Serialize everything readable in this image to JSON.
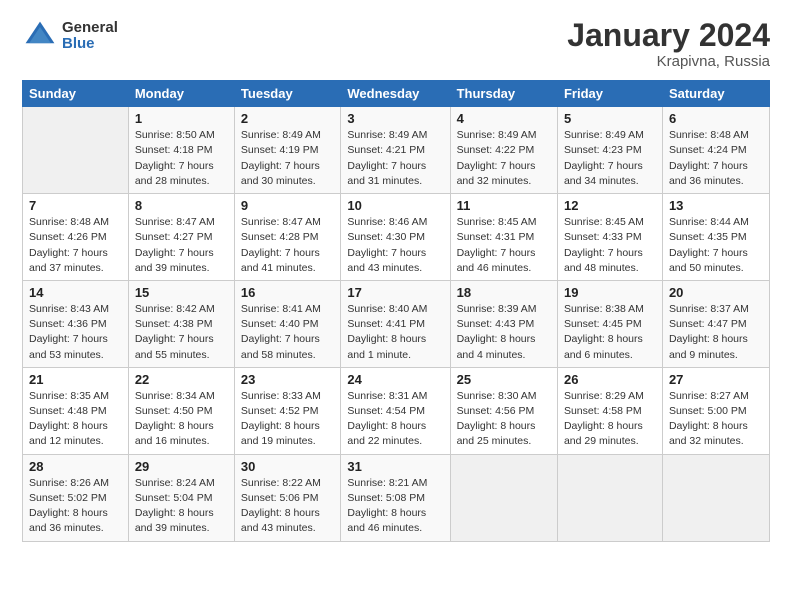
{
  "logo": {
    "general": "General",
    "blue": "Blue"
  },
  "title": "January 2024",
  "subtitle": "Krapivna, Russia",
  "days_header": [
    "Sunday",
    "Monday",
    "Tuesday",
    "Wednesday",
    "Thursday",
    "Friday",
    "Saturday"
  ],
  "weeks": [
    [
      {
        "day": "",
        "sunrise": "",
        "sunset": "",
        "daylight": ""
      },
      {
        "day": "1",
        "sunrise": "Sunrise: 8:50 AM",
        "sunset": "Sunset: 4:18 PM",
        "daylight": "Daylight: 7 hours and 28 minutes."
      },
      {
        "day": "2",
        "sunrise": "Sunrise: 8:49 AM",
        "sunset": "Sunset: 4:19 PM",
        "daylight": "Daylight: 7 hours and 30 minutes."
      },
      {
        "day": "3",
        "sunrise": "Sunrise: 8:49 AM",
        "sunset": "Sunset: 4:21 PM",
        "daylight": "Daylight: 7 hours and 31 minutes."
      },
      {
        "day": "4",
        "sunrise": "Sunrise: 8:49 AM",
        "sunset": "Sunset: 4:22 PM",
        "daylight": "Daylight: 7 hours and 32 minutes."
      },
      {
        "day": "5",
        "sunrise": "Sunrise: 8:49 AM",
        "sunset": "Sunset: 4:23 PM",
        "daylight": "Daylight: 7 hours and 34 minutes."
      },
      {
        "day": "6",
        "sunrise": "Sunrise: 8:48 AM",
        "sunset": "Sunset: 4:24 PM",
        "daylight": "Daylight: 7 hours and 36 minutes."
      }
    ],
    [
      {
        "day": "7",
        "sunrise": "Sunrise: 8:48 AM",
        "sunset": "Sunset: 4:26 PM",
        "daylight": "Daylight: 7 hours and 37 minutes."
      },
      {
        "day": "8",
        "sunrise": "Sunrise: 8:47 AM",
        "sunset": "Sunset: 4:27 PM",
        "daylight": "Daylight: 7 hours and 39 minutes."
      },
      {
        "day": "9",
        "sunrise": "Sunrise: 8:47 AM",
        "sunset": "Sunset: 4:28 PM",
        "daylight": "Daylight: 7 hours and 41 minutes."
      },
      {
        "day": "10",
        "sunrise": "Sunrise: 8:46 AM",
        "sunset": "Sunset: 4:30 PM",
        "daylight": "Daylight: 7 hours and 43 minutes."
      },
      {
        "day": "11",
        "sunrise": "Sunrise: 8:45 AM",
        "sunset": "Sunset: 4:31 PM",
        "daylight": "Daylight: 7 hours and 46 minutes."
      },
      {
        "day": "12",
        "sunrise": "Sunrise: 8:45 AM",
        "sunset": "Sunset: 4:33 PM",
        "daylight": "Daylight: 7 hours and 48 minutes."
      },
      {
        "day": "13",
        "sunrise": "Sunrise: 8:44 AM",
        "sunset": "Sunset: 4:35 PM",
        "daylight": "Daylight: 7 hours and 50 minutes."
      }
    ],
    [
      {
        "day": "14",
        "sunrise": "Sunrise: 8:43 AM",
        "sunset": "Sunset: 4:36 PM",
        "daylight": "Daylight: 7 hours and 53 minutes."
      },
      {
        "day": "15",
        "sunrise": "Sunrise: 8:42 AM",
        "sunset": "Sunset: 4:38 PM",
        "daylight": "Daylight: 7 hours and 55 minutes."
      },
      {
        "day": "16",
        "sunrise": "Sunrise: 8:41 AM",
        "sunset": "Sunset: 4:40 PM",
        "daylight": "Daylight: 7 hours and 58 minutes."
      },
      {
        "day": "17",
        "sunrise": "Sunrise: 8:40 AM",
        "sunset": "Sunset: 4:41 PM",
        "daylight": "Daylight: 8 hours and 1 minute."
      },
      {
        "day": "18",
        "sunrise": "Sunrise: 8:39 AM",
        "sunset": "Sunset: 4:43 PM",
        "daylight": "Daylight: 8 hours and 4 minutes."
      },
      {
        "day": "19",
        "sunrise": "Sunrise: 8:38 AM",
        "sunset": "Sunset: 4:45 PM",
        "daylight": "Daylight: 8 hours and 6 minutes."
      },
      {
        "day": "20",
        "sunrise": "Sunrise: 8:37 AM",
        "sunset": "Sunset: 4:47 PM",
        "daylight": "Daylight: 8 hours and 9 minutes."
      }
    ],
    [
      {
        "day": "21",
        "sunrise": "Sunrise: 8:35 AM",
        "sunset": "Sunset: 4:48 PM",
        "daylight": "Daylight: 8 hours and 12 minutes."
      },
      {
        "day": "22",
        "sunrise": "Sunrise: 8:34 AM",
        "sunset": "Sunset: 4:50 PM",
        "daylight": "Daylight: 8 hours and 16 minutes."
      },
      {
        "day": "23",
        "sunrise": "Sunrise: 8:33 AM",
        "sunset": "Sunset: 4:52 PM",
        "daylight": "Daylight: 8 hours and 19 minutes."
      },
      {
        "day": "24",
        "sunrise": "Sunrise: 8:31 AM",
        "sunset": "Sunset: 4:54 PM",
        "daylight": "Daylight: 8 hours and 22 minutes."
      },
      {
        "day": "25",
        "sunrise": "Sunrise: 8:30 AM",
        "sunset": "Sunset: 4:56 PM",
        "daylight": "Daylight: 8 hours and 25 minutes."
      },
      {
        "day": "26",
        "sunrise": "Sunrise: 8:29 AM",
        "sunset": "Sunset: 4:58 PM",
        "daylight": "Daylight: 8 hours and 29 minutes."
      },
      {
        "day": "27",
        "sunrise": "Sunrise: 8:27 AM",
        "sunset": "Sunset: 5:00 PM",
        "daylight": "Daylight: 8 hours and 32 minutes."
      }
    ],
    [
      {
        "day": "28",
        "sunrise": "Sunrise: 8:26 AM",
        "sunset": "Sunset: 5:02 PM",
        "daylight": "Daylight: 8 hours and 36 minutes."
      },
      {
        "day": "29",
        "sunrise": "Sunrise: 8:24 AM",
        "sunset": "Sunset: 5:04 PM",
        "daylight": "Daylight: 8 hours and 39 minutes."
      },
      {
        "day": "30",
        "sunrise": "Sunrise: 8:22 AM",
        "sunset": "Sunset: 5:06 PM",
        "daylight": "Daylight: 8 hours and 43 minutes."
      },
      {
        "day": "31",
        "sunrise": "Sunrise: 8:21 AM",
        "sunset": "Sunset: 5:08 PM",
        "daylight": "Daylight: 8 hours and 46 minutes."
      },
      {
        "day": "",
        "sunrise": "",
        "sunset": "",
        "daylight": ""
      },
      {
        "day": "",
        "sunrise": "",
        "sunset": "",
        "daylight": ""
      },
      {
        "day": "",
        "sunrise": "",
        "sunset": "",
        "daylight": ""
      }
    ]
  ]
}
